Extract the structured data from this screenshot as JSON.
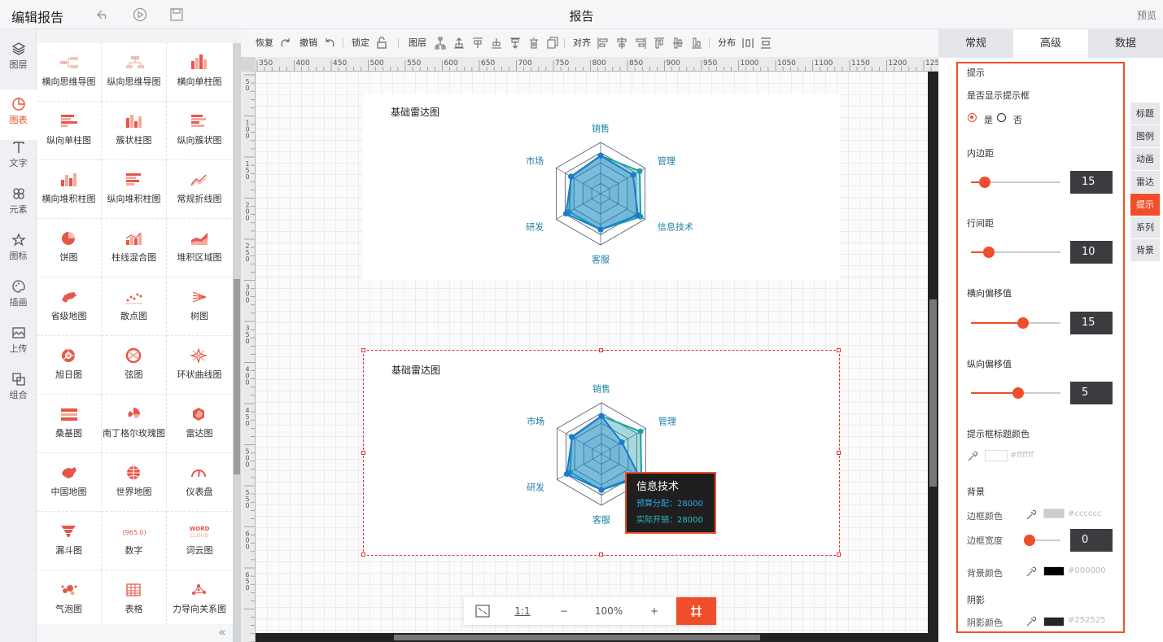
{
  "app": {
    "title": "编辑报告",
    "doc_title": "报告",
    "preview": "预览"
  },
  "leftnav": [
    {
      "label": "图层",
      "icon": "layers-icon"
    },
    {
      "label": "图表",
      "icon": "chart-pie-icon",
      "active": true
    },
    {
      "label": "文字",
      "icon": "text-icon"
    },
    {
      "label": "元素",
      "icon": "elements-icon"
    },
    {
      "label": "图标",
      "icon": "star-icon"
    },
    {
      "label": "插画",
      "icon": "palette-icon"
    },
    {
      "label": "上传",
      "icon": "upload-image-icon"
    },
    {
      "label": "组合",
      "icon": "group-icon"
    }
  ],
  "gallery": [
    {
      "label": "横向思维导图",
      "icon": "mindmap-h-icon"
    },
    {
      "label": "纵向思维导图",
      "icon": "mindmap-v-icon"
    },
    {
      "label": "横向单柱图",
      "icon": "bar-vertical-icon"
    },
    {
      "label": "纵向单柱图",
      "icon": "bar-horizontal-icon"
    },
    {
      "label": "簇状柱图",
      "icon": "bar-cluster-icon"
    },
    {
      "label": "纵向簇状图",
      "icon": "bar-cluster-h-icon"
    },
    {
      "label": "横向堆积柱图",
      "icon": "bar-stacked-icon"
    },
    {
      "label": "纵向堆积柱图",
      "icon": "bar-stacked-h-icon"
    },
    {
      "label": "常规折线图",
      "icon": "line-chart-icon"
    },
    {
      "label": "饼图",
      "icon": "pie-icon"
    },
    {
      "label": "柱线混合图",
      "icon": "bar-line-icon"
    },
    {
      "label": "堆积区域图",
      "icon": "area-icon"
    },
    {
      "label": "省级地图",
      "icon": "province-map-icon"
    },
    {
      "label": "散点图",
      "icon": "scatter-icon"
    },
    {
      "label": "树图",
      "icon": "tree-icon"
    },
    {
      "label": "旭日图",
      "icon": "sunburst-icon"
    },
    {
      "label": "弦图",
      "icon": "chord-icon"
    },
    {
      "label": "环状曲线图",
      "icon": "ring-curve-icon"
    },
    {
      "label": "桑基图",
      "icon": "sankey-icon"
    },
    {
      "label": "南丁格尔玫瑰图",
      "icon": "rose-icon"
    },
    {
      "label": "雷达图",
      "icon": "radar-icon"
    },
    {
      "label": "中国地图",
      "icon": "china-map-icon"
    },
    {
      "label": "世界地图",
      "icon": "globe-icon"
    },
    {
      "label": "仪表盘",
      "icon": "gauge-icon"
    },
    {
      "label": "漏斗图",
      "icon": "funnel-icon"
    },
    {
      "label": "数字",
      "icon": "number-icon",
      "text": "965.0"
    },
    {
      "label": "词云图",
      "icon": "word-cloud-icon",
      "text1": "WORD",
      "text2": "CLOUD"
    },
    {
      "label": "气泡图",
      "icon": "bubble-icon"
    },
    {
      "label": "表格",
      "icon": "table-icon"
    },
    {
      "label": "力导向关系图",
      "icon": "force-graph-icon"
    }
  ],
  "toolbar": {
    "redo": "恢复",
    "undo": "撤销",
    "lock": "锁定",
    "layer": "图层",
    "align": "对齐",
    "distribute": "分布"
  },
  "ruler": {
    "h": [
      "350",
      "400",
      "450",
      "500",
      "550",
      "600",
      "650",
      "700",
      "750",
      "800",
      "850",
      "900",
      "950",
      "1000",
      "1050",
      "1100",
      "1150",
      "1200",
      "1250"
    ],
    "v": [
      "50",
      "100",
      "150",
      "200",
      "250",
      "300",
      "350",
      "400",
      "450",
      "500",
      "550",
      "600",
      "650"
    ]
  },
  "charts": [
    {
      "title": "基础雷达图"
    },
    {
      "title": "基础雷达图"
    }
  ],
  "chart_data": [
    {
      "type": "radar",
      "title": "基础雷达图",
      "indicators": [
        "销售",
        "管理",
        "信息技术",
        "客服",
        "研发",
        "市场"
      ],
      "series": [
        {
          "values": [
            0.74,
            0.73,
            0.84,
            0.7,
            0.78,
            0.66
          ],
          "color": "#1a7ad0"
        },
        {
          "values": [
            0.74,
            0.88,
            0.9,
            0.7,
            0.71,
            0.67
          ],
          "color": "#15a3a6"
        }
      ]
    },
    {
      "type": "radar",
      "title": "基础雷达图",
      "indicators": [
        "销售",
        "管理",
        "信息技术",
        "客服",
        "研发",
        "市场"
      ],
      "series": [
        {
          "values": [
            0.74,
            0.46,
            0.84,
            0.7,
            0.78,
            0.66
          ],
          "color": "#1a7ad0"
        },
        {
          "values": [
            0.74,
            0.88,
            0.9,
            0.7,
            0.71,
            0.67
          ],
          "color": "#15a3a6"
        }
      ],
      "tooltip": {
        "title": "信息技术",
        "rows": [
          {
            "label": "预算分配",
            "value": "28000"
          },
          {
            "label": "实际开销",
            "value": "28000"
          }
        ]
      }
    }
  ],
  "zoom": {
    "level": "100%",
    "one_to_one": "1:1",
    "minus": "−",
    "plus": "+"
  },
  "tabs": [
    {
      "label": "常规"
    },
    {
      "label": "高级",
      "active": true
    },
    {
      "label": "数据"
    }
  ],
  "panel": {
    "section": "提示",
    "show_tooltip_label": "是否显示提示框",
    "radio_yes": "是",
    "radio_no": "否",
    "padding_label": "内边距",
    "padding_value": "15",
    "padding_pct": 0.15,
    "line_spacing_label": "行间距",
    "line_spacing_value": "10",
    "line_spacing_pct": 0.2,
    "h_offset_label": "横向偏移值",
    "h_offset_value": "15",
    "h_offset_pct": 0.58,
    "v_offset_label": "纵向偏移值",
    "v_offset_value": "5",
    "v_offset_pct": 0.53,
    "title_color_label": "提示框标题颜色",
    "title_color": "#ffffff",
    "bg_section": "背景",
    "border_color_label": "边框颜色",
    "border_color": "#cccccc",
    "border_width_label": "边框宽度",
    "border_width_value": "0",
    "border_width_pct": 0,
    "bg_color_label": "背景颜色",
    "bg_color": "#000000",
    "shadow_section": "阴影",
    "shadow_color_label": "阴影颜色",
    "shadow_color": "#252525"
  },
  "sidetabs": [
    {
      "label": "标题"
    },
    {
      "label": "图例"
    },
    {
      "label": "动画"
    },
    {
      "label": "雷达"
    },
    {
      "label": "提示",
      "active": true
    },
    {
      "label": "系列"
    },
    {
      "label": "背景"
    }
  ],
  "colors": {
    "accent": "#f04e2a",
    "radar_line": "#1a7ad0",
    "radar_teal": "#15a3a6",
    "label": "#1c7fa6"
  }
}
